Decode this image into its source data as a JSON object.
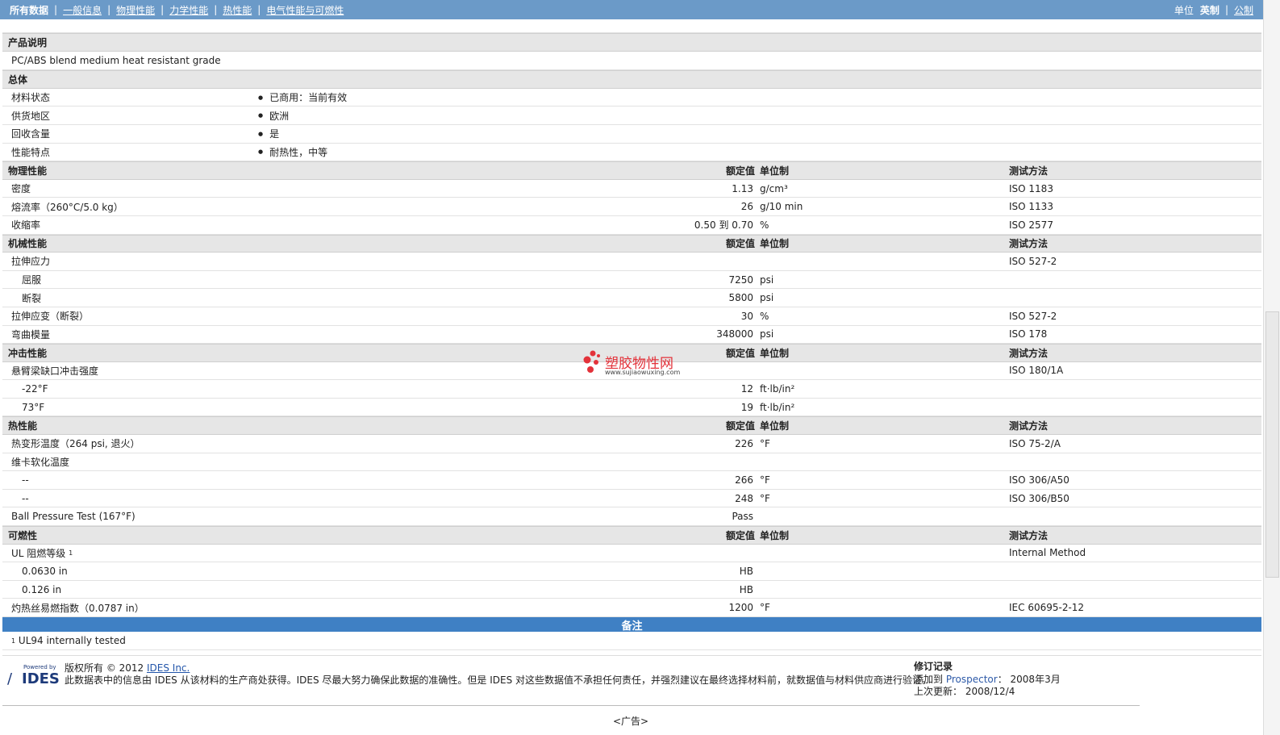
{
  "nav": {
    "items": [
      "所有数据",
      "一般信息",
      "物理性能",
      "力学性能",
      "热性能",
      "电气性能与可燃性"
    ],
    "unit_label": "单位",
    "units": [
      "英制",
      "公制"
    ]
  },
  "product": {
    "section": "产品说明",
    "description": "PC/ABS blend medium heat resistant grade"
  },
  "general": {
    "section": "总体",
    "rows": [
      {
        "name": "材料状态",
        "value": "已商用：当前有效"
      },
      {
        "name": "供货地区",
        "value": "欧洲"
      },
      {
        "name": "回收含量",
        "value": "是"
      },
      {
        "name": "性能特点",
        "value": "耐热性，中等"
      }
    ]
  },
  "headers": {
    "value": "额定值",
    "unit": "单位制",
    "method": "测试方法"
  },
  "physical": {
    "section": "物理性能",
    "rows": [
      {
        "name": "密度",
        "value": "1.13",
        "unit": "g/cm³",
        "method": "ISO 1183"
      },
      {
        "name": "熔流率（260°C/5.0 kg）",
        "value": "26",
        "unit": "g/10 min",
        "method": "ISO 1133"
      },
      {
        "name": "收缩率",
        "value": "0.50 到  0.70",
        "unit": "%",
        "method": "ISO 2577"
      }
    ]
  },
  "mechanical": {
    "section": "机械性能",
    "rows": [
      {
        "name": "拉伸应力",
        "value": "",
        "unit": "",
        "method": "ISO 527-2",
        "sub": false
      },
      {
        "name": "屈服",
        "value": "7250",
        "unit": "psi",
        "method": "",
        "sub": true
      },
      {
        "name": "断裂",
        "value": "5800",
        "unit": "psi",
        "method": "",
        "sub": true
      },
      {
        "name": "拉伸应变（断裂）",
        "value": "30",
        "unit": "%",
        "method": "ISO 527-2",
        "sub": false
      },
      {
        "name": "弯曲模量",
        "value": "348000",
        "unit": "psi",
        "method": "ISO 178",
        "sub": false
      }
    ]
  },
  "impact": {
    "section": "冲击性能",
    "rows": [
      {
        "name": "悬臂梁缺口冲击强度",
        "value": "",
        "unit": "",
        "method": "ISO 180/1A",
        "sub": false
      },
      {
        "name": "-22°F",
        "value": "12",
        "unit": "ft·lb/in²",
        "method": "",
        "sub": true
      },
      {
        "name": "73°F",
        "value": "19",
        "unit": "ft·lb/in²",
        "method": "",
        "sub": true
      }
    ]
  },
  "thermal": {
    "section": "热性能",
    "rows": [
      {
        "name": "热变形温度（264 psi, 退火）",
        "value": "226",
        "unit": "°F",
        "method": "ISO 75-2/A",
        "sub": false
      },
      {
        "name": "维卡软化温度",
        "value": "",
        "unit": "",
        "method": "",
        "sub": false
      },
      {
        "name": "--",
        "value": "266",
        "unit": "°F",
        "method": "ISO 306/A50",
        "sub": true
      },
      {
        "name": "--",
        "value": "248",
        "unit": "°F",
        "method": "ISO 306/B50",
        "sub": true
      },
      {
        "name": "Ball Pressure Test (167°F)",
        "value": "Pass",
        "unit": "",
        "method": "",
        "sub": false
      }
    ]
  },
  "flammability": {
    "section": "可燃性",
    "rows": [
      {
        "name": "UL 阻燃等级",
        "sup": "1",
        "value": "",
        "unit": "",
        "method": "Internal Method",
        "sub": false
      },
      {
        "name": "0.0630 in",
        "value": "HB",
        "unit": "",
        "method": "",
        "sub": true
      },
      {
        "name": "0.126 in",
        "value": "HB",
        "unit": "",
        "method": "",
        "sub": true
      },
      {
        "name": "灼热丝易燃指数（0.0787 in）",
        "value": "1200",
        "unit": "°F",
        "method": "IEC 60695-2-12",
        "sub": false
      }
    ]
  },
  "notes": {
    "title": "备注",
    "footnote_num": "1",
    "footnote": "UL94 internally tested"
  },
  "footer": {
    "logo_powered": "Powered by",
    "logo_brand": "IDES",
    "copyright_prefix": "版权所有 © 2012 ",
    "copyright_link": "IDES Inc.",
    "disclaimer": "此数据表中的信息由 IDES 从该材料的生产商处获得。IDES 尽最大努力确保此数据的准确性。但是 IDES 对这些数据值不承担任何责任，并强烈建议在最终选择材料前，就数据值与材料供应商进行验证。",
    "history_title": "修订记录",
    "added_label": "添加到 ",
    "added_source": "Prospector",
    "added_colon": "： ",
    "added_date": "2008年3月",
    "updated_label": "上次更新： ",
    "updated_date": "2008/12/4",
    "ad": "<广告>"
  },
  "watermark": {
    "text": "塑胶物性网",
    "url": "www.sujiaowuxing.com",
    "color": "#e3323a"
  },
  "colors": {
    "nav_bg": "#6b9ac8",
    "section_bg": "#e6e6e6",
    "notes_bg": "#3f80c4"
  }
}
